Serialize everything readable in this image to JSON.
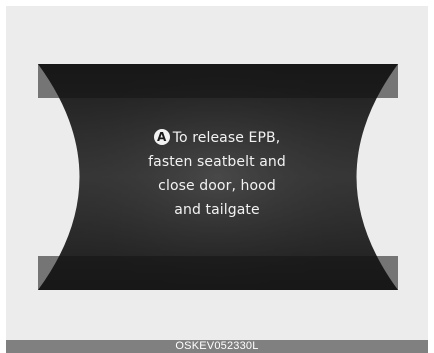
{
  "display": {
    "badge": "A",
    "lines": [
      "To release EPB,",
      "fasten seatbelt and",
      "close door, hood",
      "and tailgate"
    ]
  },
  "caption": "OSKEV052330L"
}
